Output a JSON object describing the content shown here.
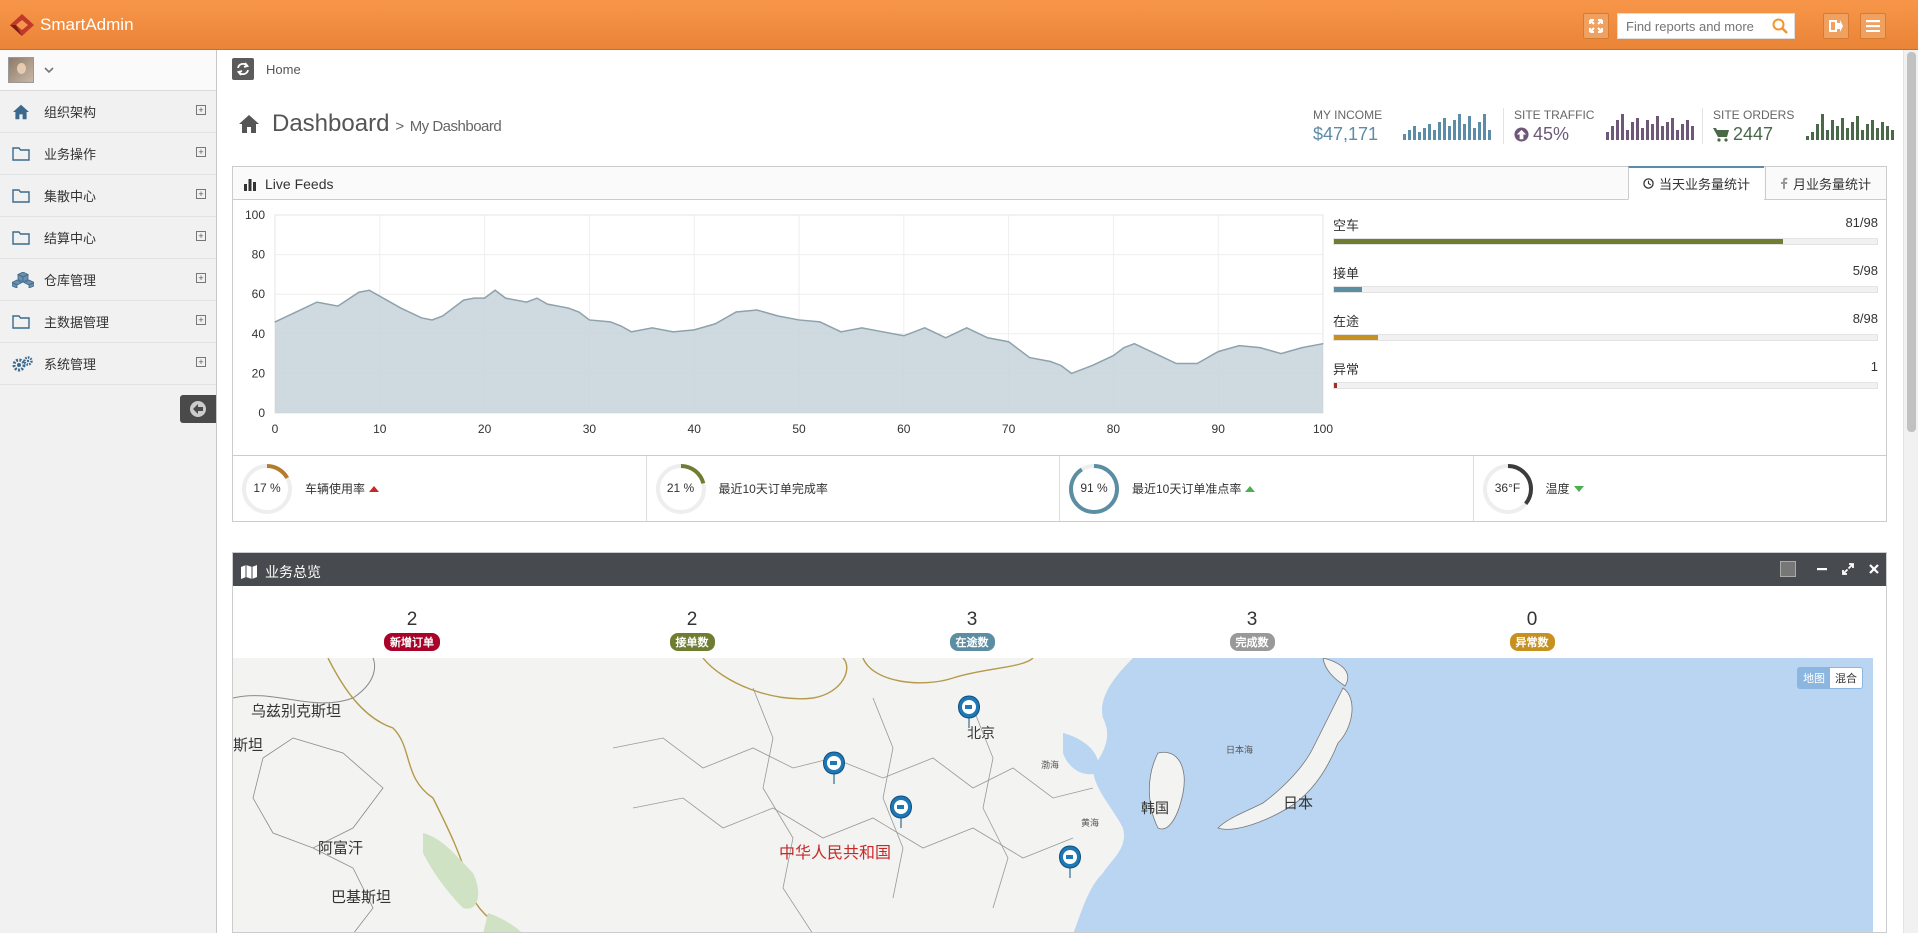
{
  "app": {
    "name": "SmartAdmin"
  },
  "header": {
    "search_placeholder": "Find reports and more"
  },
  "sidebar": {
    "items": [
      {
        "label": "组织架构",
        "icon": "home-icon"
      },
      {
        "label": "业务操作",
        "icon": "folder-icon"
      },
      {
        "label": "集散中心",
        "icon": "folder-icon"
      },
      {
        "label": "结算中心",
        "icon": "folder-icon"
      },
      {
        "label": "仓库管理",
        "icon": "cubes-icon"
      },
      {
        "label": "主数据管理",
        "icon": "folder-icon"
      },
      {
        "label": "系统管理",
        "icon": "gears-icon"
      }
    ]
  },
  "breadcrumb": {
    "home": "Home"
  },
  "page": {
    "title": "Dashboard",
    "separator": ">",
    "subtitle": "My Dashboard"
  },
  "stats": {
    "income": {
      "label": "MY INCOME",
      "value": "$47,171",
      "color": "#5d8ca8"
    },
    "traffic": {
      "label": "SITE TRAFFIC",
      "value": "45%",
      "color": "#6e587a"
    },
    "orders": {
      "label": "SITE ORDERS",
      "value": "2447",
      "color": "#496949"
    }
  },
  "live_feeds": {
    "title": "Live Feeds",
    "tabs": [
      {
        "label": "当天业务量统计",
        "active": true
      },
      {
        "label": "月业务量统计",
        "active": false
      }
    ],
    "progress": [
      {
        "label": "空车",
        "value": "81/98",
        "fraction": 0.8265,
        "color": "#6e7d32"
      },
      {
        "label": "接单",
        "value": "5/98",
        "fraction": 0.051,
        "color": "#5c8ea3"
      },
      {
        "label": "在途",
        "value": "8/98",
        "fraction": 0.0816,
        "color": "#c79121"
      },
      {
        "label": "异常",
        "value": "1",
        "fraction": 0.004,
        "color": "#a03030"
      }
    ],
    "kpis": [
      {
        "value": "17 %",
        "label": "车辆使用率",
        "percent": 17,
        "color": "#b37c2a",
        "trend": "up"
      },
      {
        "value": "21 %",
        "label": "最近10天订单完成率",
        "percent": 21,
        "color": "#6e7d32",
        "trend": "none"
      },
      {
        "value": "91 %",
        "label": "最近10天订单准点率",
        "percent": 91,
        "color": "#5c8ea3",
        "trend": "up"
      },
      {
        "value": "36°F",
        "label": "温度",
        "percent": 36,
        "color": "#3c3c3c",
        "trend": "down"
      }
    ]
  },
  "chart_data": {
    "type": "area",
    "x": [
      0,
      2,
      4,
      6,
      8,
      9,
      10,
      12,
      14,
      15,
      16,
      18,
      19,
      20,
      21,
      22,
      24,
      25,
      26,
      28,
      29,
      30,
      32,
      33,
      34,
      36,
      38,
      40,
      42,
      44,
      46,
      48,
      50,
      52,
      54,
      56,
      58,
      60,
      62,
      64,
      66,
      68,
      70,
      72,
      74,
      75,
      76,
      78,
      80,
      81,
      82,
      84,
      86,
      88,
      90,
      92,
      94,
      96,
      98,
      100
    ],
    "values": [
      46,
      51,
      56,
      54,
      61,
      62,
      59,
      53,
      48,
      47,
      49,
      57,
      58,
      58,
      62,
      58,
      56,
      58,
      55,
      53,
      51,
      47,
      46,
      44,
      41,
      43,
      41,
      42,
      45,
      51,
      52,
      49,
      47,
      46,
      41,
      43,
      41,
      39,
      43,
      38,
      43,
      38,
      36,
      28,
      26,
      24,
      20,
      24,
      29,
      33,
      35,
      30,
      25,
      25,
      31,
      34,
      33,
      30,
      33,
      35
    ],
    "xlim": [
      0,
      100
    ],
    "ylim": [
      0,
      100
    ],
    "xticks": [
      0,
      10,
      20,
      30,
      40,
      50,
      60,
      70,
      80,
      90,
      100
    ],
    "yticks": [
      0,
      20,
      40,
      60,
      80,
      100
    ],
    "grid": true,
    "fill_color": "#c6d3da",
    "line_color": "#8ea2ad"
  },
  "overview": {
    "title": "业务总览",
    "counts": [
      {
        "value": "2",
        "label": "新增订单",
        "color": "#a90329"
      },
      {
        "value": "2",
        "label": "接单数",
        "color": "#6e7d32"
      },
      {
        "value": "3",
        "label": "在途数",
        "color": "#5c8ea3"
      },
      {
        "value": "3",
        "label": "完成数",
        "color": "#999999"
      },
      {
        "value": "0",
        "label": "异常数",
        "color": "#c79121"
      }
    ],
    "map": {
      "type_buttons": [
        "地图",
        "混合"
      ],
      "labels": [
        "乌兹别克斯坦",
        "斯坦",
        "阿富汗",
        "巴基斯坦",
        "北京",
        "中华人民共和国",
        "韩国",
        "日本",
        "渤海",
        "黄海",
        "日本海"
      ]
    }
  }
}
